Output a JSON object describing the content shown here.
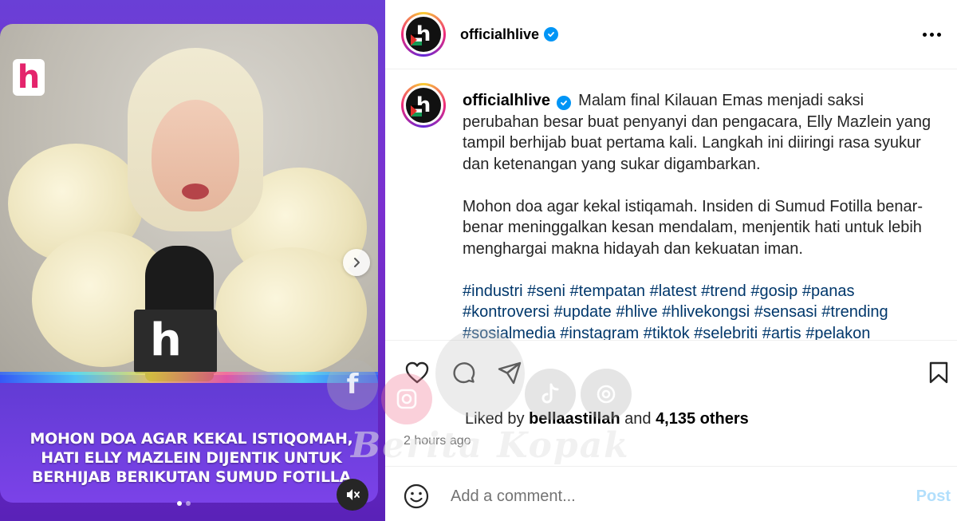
{
  "post": {
    "username": "officialhlive",
    "more_icon": "more-horizontal-icon"
  },
  "media": {
    "logo_letter": "h",
    "mic_letter": "h",
    "headline_lines": [
      "MOHON DOA AGAR KEKAL ISTIQOMAH,",
      "HATI ELLY MAZLEIN DIJENTIK UNTUK",
      "BERHIJAB BERIKUTAN SUMUD FOTILLA"
    ],
    "carousel_total": 2,
    "carousel_active": 1
  },
  "caption": {
    "username": "officialhlive",
    "paragraph1": "Malam final Kilauan Emas menjadi saksi perubahan besar buat penyanyi dan pengacara, Elly Mazlein yang tampil berhijab buat pertama kali. Langkah ini diiringi rasa syukur dan ketenangan yang sukar digambarkan.",
    "paragraph2": "Mohon doa agar kekal istiqamah. Insiden di Sumud Fotilla benar-benar meninggalkan kesan mendalam, menjentik hati untuk lebih menghargai makna hidayah dan kekuatan iman.",
    "hashtags": "#industri #seni #tempatan #latest #trend #gosip #panas #kontroversi #update #hlive #hlivekongsi #sensasi #trending #sosialmedia #instagram #tiktok #selebriti #artis #pelakon"
  },
  "engagement": {
    "liked_prefix": "Liked by",
    "liked_user": "bellaastillah",
    "liked_and": "and",
    "liked_others": "4,135 others",
    "time_ago": "2 hours ago"
  },
  "comment": {
    "placeholder": "Add a comment...",
    "post_label": "Post"
  },
  "watermark": {
    "brand": "Berita Kopak",
    "facebook_letter": "f"
  },
  "colors": {
    "verified": "#0095f6",
    "hashtag": "#00376b",
    "post_disabled": "#b2dffc"
  }
}
